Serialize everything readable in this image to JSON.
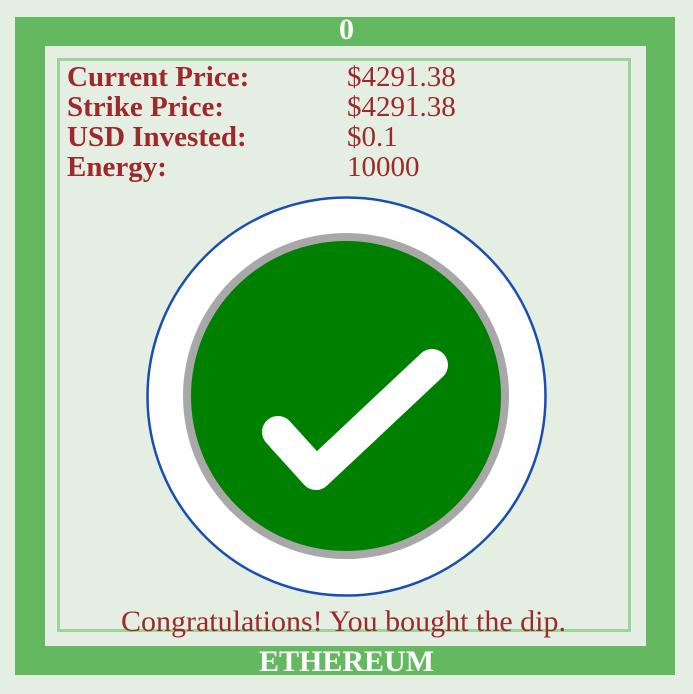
{
  "game": {
    "score": "0",
    "title": "ETHEREUM",
    "message": "Congratulations! You bought the dip."
  },
  "stats": [
    {
      "label": "Current Price:",
      "value": "$4291.38"
    },
    {
      "label": "Strike Price:",
      "value": "$4291.38"
    },
    {
      "label": "USD Invested:",
      "value": "$0.1"
    },
    {
      "label": "Energy:",
      "value": "10000"
    }
  ],
  "colors": {
    "frame": "#64b860",
    "text": "#9c2a2a",
    "check_circle": "#008000",
    "ring": "#1a4fb0"
  },
  "icon": "checkmark-icon"
}
